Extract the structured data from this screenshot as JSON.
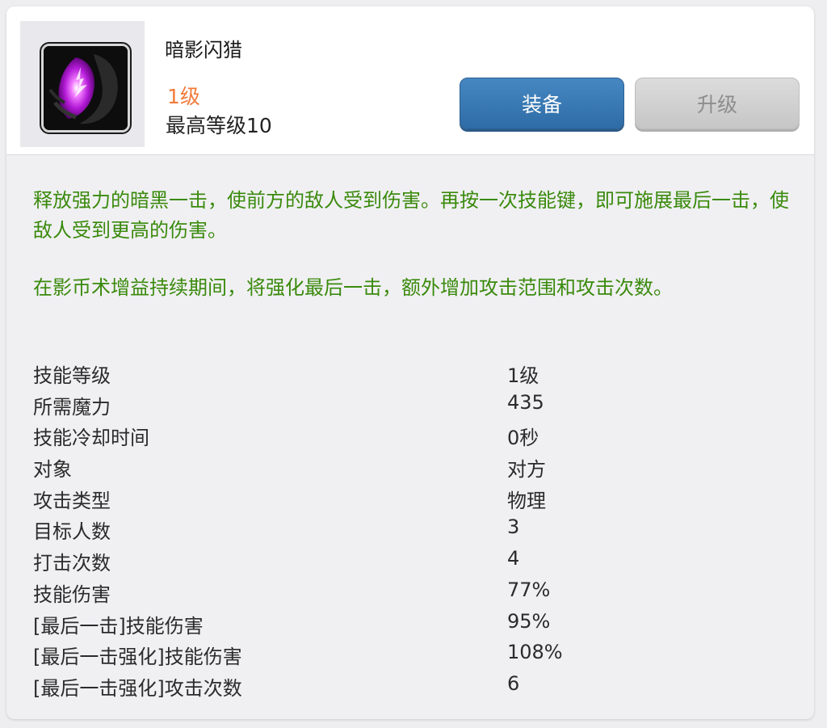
{
  "skill": {
    "name": "暗影闪猎",
    "level": "1级",
    "max_level": "最高等级10",
    "icon": "shadow-flash-skill-icon"
  },
  "buttons": {
    "equip": "装备",
    "upgrade": "升级"
  },
  "description": [
    "释放强力的暗黑一击，使前方的敌人受到伤害。再按一次技能键，即可施展最后一击，使敌人受到更高的伤害。",
    "在影币术增益持续期间，将强化最后一击，额外增加攻击范围和攻击次数。"
  ],
  "stats": [
    {
      "label": "技能等级",
      "value": "1级"
    },
    {
      "label": "所需魔力",
      "value": "435"
    },
    {
      "label": "技能冷却时间",
      "value": "0秒"
    },
    {
      "label": "对象",
      "value": "对方"
    },
    {
      "label": "攻击类型",
      "value": "物理"
    },
    {
      "label": "目标人数",
      "value": "3"
    },
    {
      "label": "打击次数",
      "value": "4"
    },
    {
      "label": "技能伤害",
      "value": "77%"
    },
    {
      "label": "[最后一击]技能伤害",
      "value": "95%"
    },
    {
      "label": "[最后一击强化]技能伤害",
      "value": "108%"
    },
    {
      "label": "[最后一击强化]攻击次数",
      "value": "6"
    }
  ],
  "colors": {
    "level_accent": "#f27b3a",
    "description_text": "#3a8a0c",
    "equip_button": "#3a7ab6",
    "upgrade_button_disabled": "#cfcfcf"
  }
}
